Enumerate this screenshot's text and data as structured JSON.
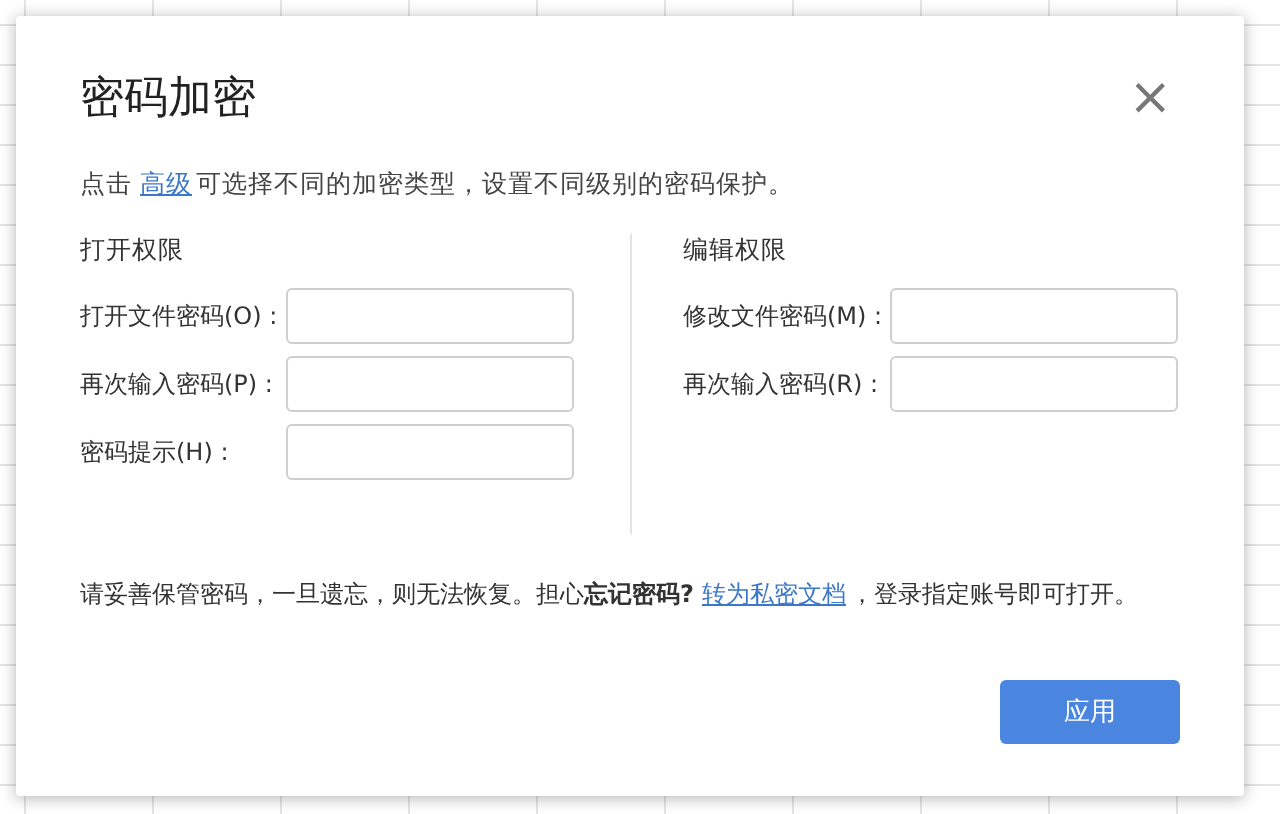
{
  "dialog": {
    "title": "密码加密",
    "close": "×",
    "intro": {
      "before": "点击",
      "link": "高级",
      "after": "可选择不同的加密类型，设置不同级别的密码保护。"
    },
    "sections": [
      {
        "heading": "打开权限",
        "fields": [
          {
            "label": "打开文件密码(O) :"
          },
          {
            "label": "再次输入密码(P) :"
          },
          {
            "label": "密码提示(H) :"
          }
        ]
      },
      {
        "heading": "编辑权限",
        "fields": [
          {
            "label": "修改文件密码(M) :"
          },
          {
            "label": "再次输入密码(R) :"
          }
        ]
      }
    ],
    "notice": {
      "before": "请妥善保管密码，一旦遗忘，则无法恢复。担心**忘记密码?**",
      "link": "转为私密文档",
      "after": "，登录指定账号即可打开。"
    },
    "buttons": [
      "应用"
    ]
  }
}
